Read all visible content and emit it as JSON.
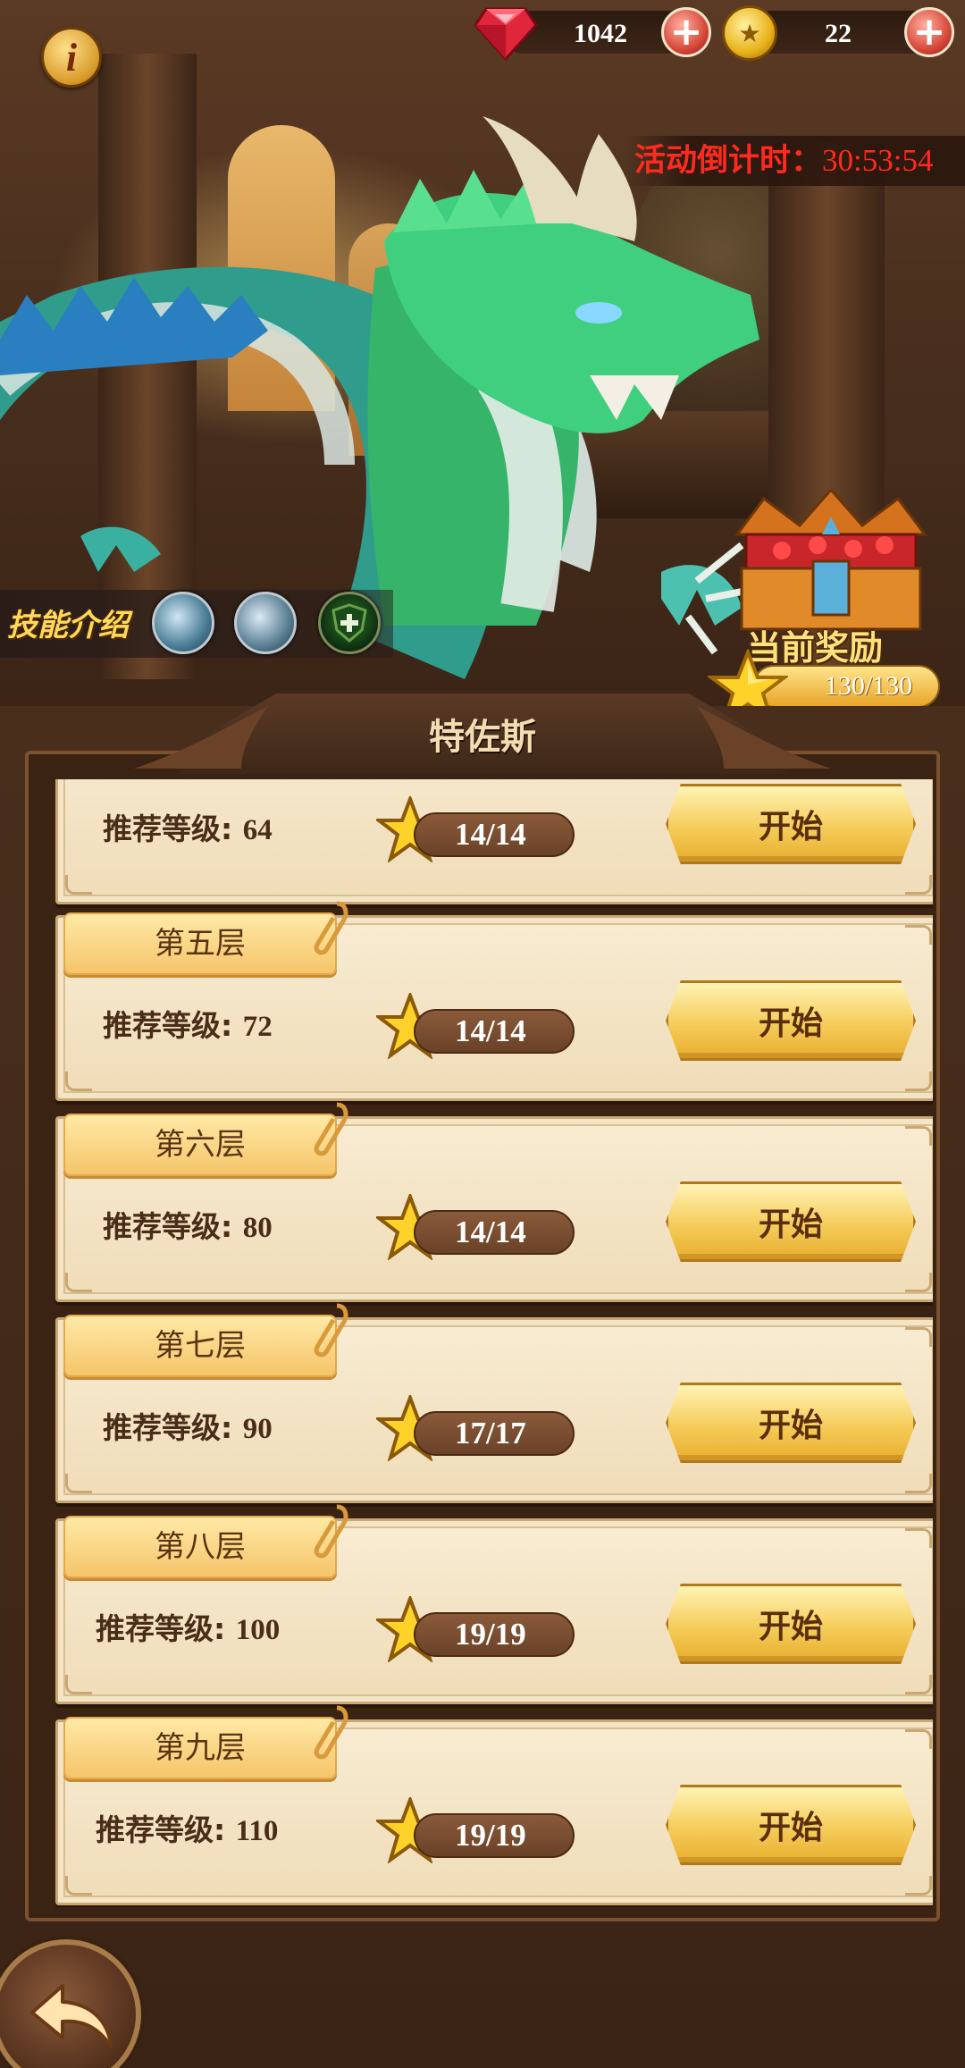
{
  "top_bar": {
    "gems": "1042",
    "coins": "22",
    "plus": "+",
    "info": "i",
    "gem_icon": "ruby-gem-icon",
    "coin_icon": "gold-coin-icon"
  },
  "event": {
    "countdown_label": "活动倒计时：",
    "countdown_time": "30:53:54"
  },
  "skills": {
    "label": "技能介绍",
    "icons": [
      "ice-dragon-skill-icon",
      "frost-claw-skill-icon",
      "green-shield-skill-icon"
    ]
  },
  "reward": {
    "label": "当前奖励",
    "progress": "130/130",
    "icon": "treasure-chest-icon"
  },
  "boss": {
    "name": "特佐斯"
  },
  "floors": [
    {
      "tag": "",
      "level_label": "推荐等级:",
      "level": "64",
      "stars": "14/14",
      "start": "开始"
    },
    {
      "tag": "第五层",
      "level_label": "推荐等级:",
      "level": "72",
      "stars": "14/14",
      "start": "开始"
    },
    {
      "tag": "第六层",
      "level_label": "推荐等级:",
      "level": "80",
      "stars": "14/14",
      "start": "开始"
    },
    {
      "tag": "第七层",
      "level_label": "推荐等级:",
      "level": "90",
      "stars": "17/17",
      "start": "开始"
    },
    {
      "tag": "第八层",
      "level_label": "推荐等级:",
      "level": "100",
      "stars": "19/19",
      "start": "开始"
    },
    {
      "tag": "第九层",
      "level_label": "推荐等级:",
      "level": "110",
      "stars": "19/19",
      "start": "开始"
    }
  ],
  "colors": {
    "accent_red": "#ff2a1e",
    "gold": "#f5cc5a",
    "card_bg": "#f8ecd2",
    "panel_bg": "#3b2314"
  }
}
